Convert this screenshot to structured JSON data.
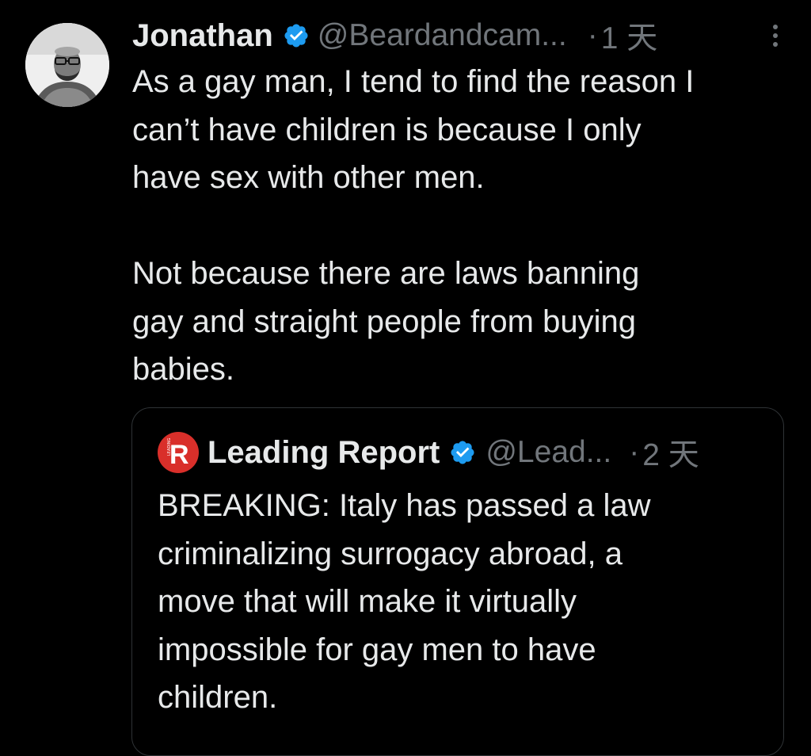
{
  "tweet": {
    "author_name": "Jonathan",
    "handle": "@Beardandcam...",
    "separator": "·",
    "time": "1 天",
    "text": "As a gay man, I tend to find the reason I\ncan’t have children is because I only\nhave sex with other men.\n\nNot because there are laws banning\ngay and straight people from buying\nbabies.",
    "icons": {
      "verified": "verified-badge-icon",
      "more": "more-options-icon",
      "avatar": "avatar"
    }
  },
  "quoted_tweet": {
    "author_name": "Leading Report",
    "handle": "@Lead...",
    "separator": "·",
    "time": "2 天",
    "logo_letter": "R",
    "logo_side_text": "LEADING",
    "text": "BREAKING: Italy has passed a law\ncriminalizing surrogacy abroad, a\nmove that will make it virtually\nimpossible for gay men to have\nchildren."
  },
  "colors": {
    "background": "#000000",
    "text": "#e7e9ea",
    "muted": "#71767b",
    "verified": "#1d9bf0",
    "border": "#2f3336",
    "logo_red": "#d92f2a"
  }
}
